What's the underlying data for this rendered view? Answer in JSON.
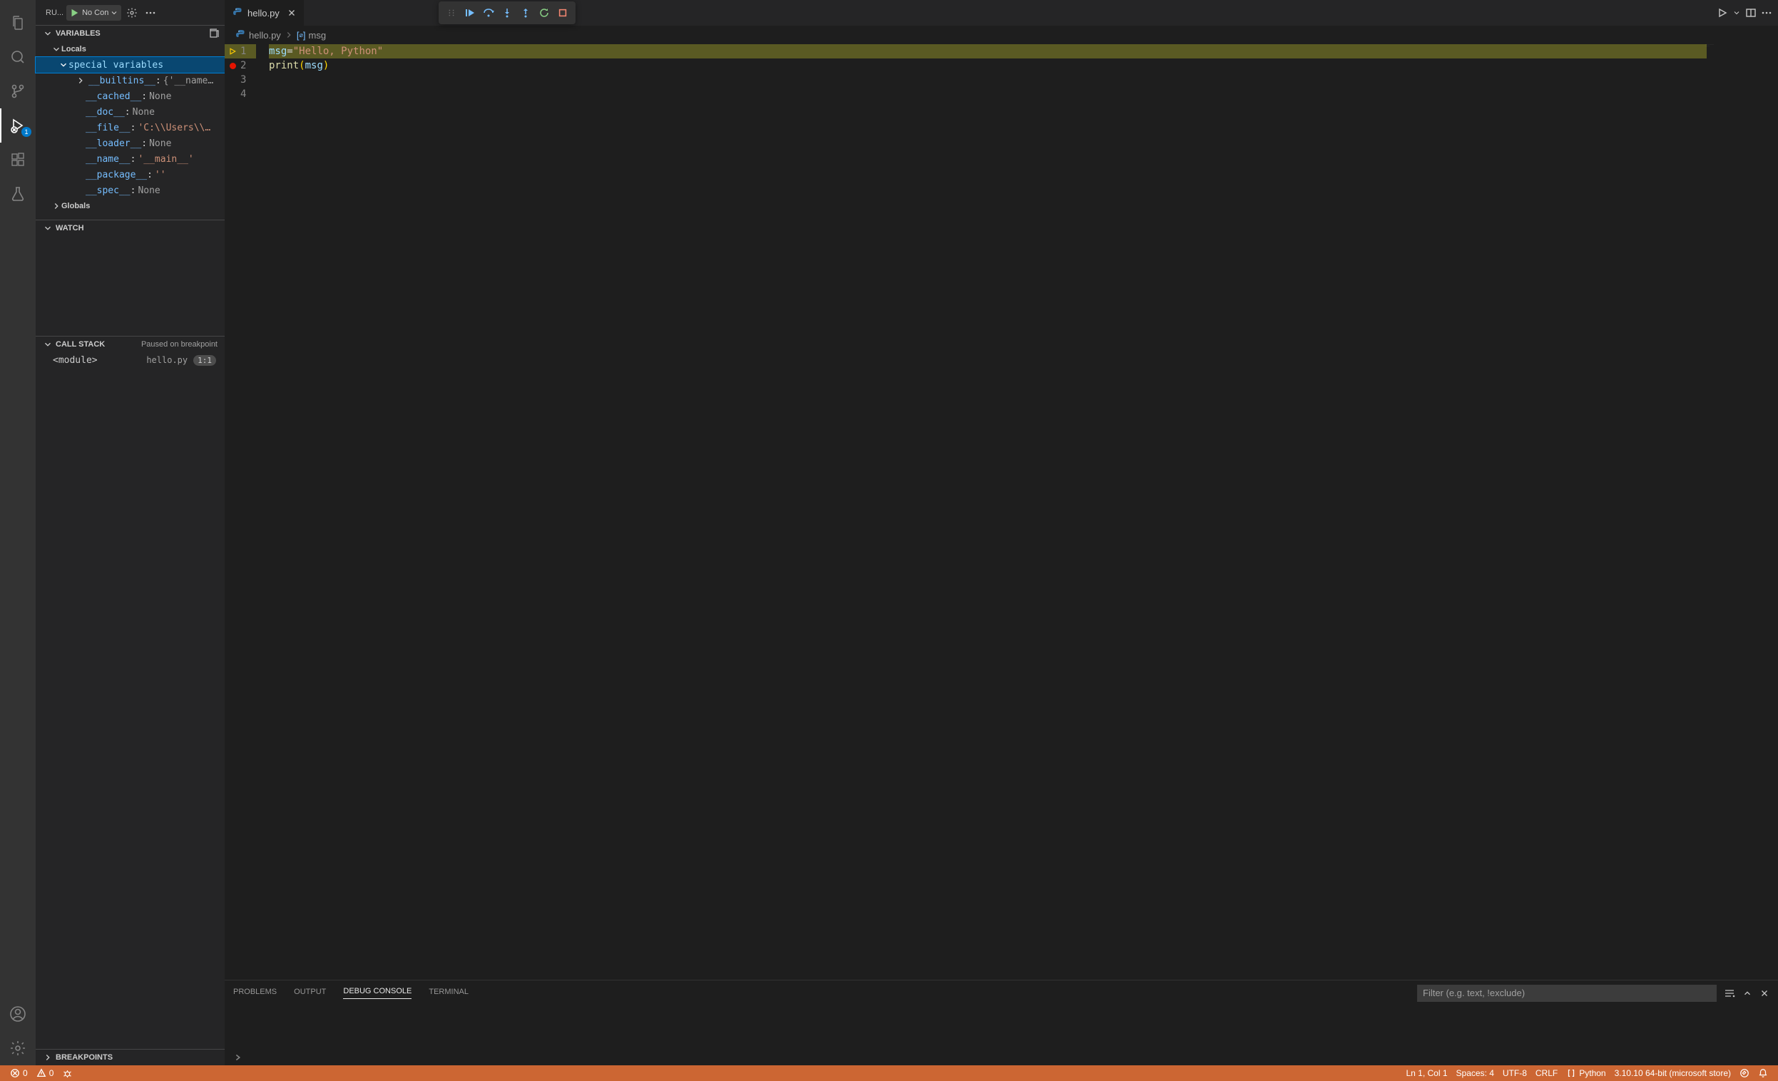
{
  "sidebar": {
    "title": "RU...",
    "run_config": "No Con",
    "sections": {
      "variables": "VARIABLES",
      "watch": "WATCH",
      "callstack": "CALL STACK",
      "callstack_status": "Paused on breakpoint",
      "breakpoints": "BREAKPOINTS"
    },
    "scopes": {
      "locals": "Locals",
      "globals": "Globals"
    },
    "special_vars": "special variables",
    "vars": [
      {
        "name": "__builtins__",
        "value": "{'__name…",
        "expandable": true
      },
      {
        "name": "__cached__",
        "value": "None"
      },
      {
        "name": "__doc__",
        "value": "None"
      },
      {
        "name": "__file__",
        "value": "'C:\\\\Users\\\\…",
        "string": true
      },
      {
        "name": "__loader__",
        "value": "None"
      },
      {
        "name": "__name__",
        "value": "'__main__'",
        "string": true
      },
      {
        "name": "__package__",
        "value": "''",
        "string": true
      },
      {
        "name": "__spec__",
        "value": "None"
      }
    ],
    "stack": {
      "frame": "<module>",
      "file": "hello.py",
      "loc": "1:1"
    }
  },
  "editor": {
    "tab": "hello.py",
    "breadcrumb_file": "hello.py",
    "breadcrumb_symbol": "msg",
    "lines": {
      "l1": "1",
      "l2": "2",
      "l3": "3",
      "l4": "4"
    },
    "code": {
      "msg": "msg",
      "eq": " = ",
      "str": "\"Hello, Python\"",
      "print": "print",
      "lpar": "(",
      "arg": "msg",
      "rpar": ")"
    }
  },
  "panel": {
    "tabs": {
      "problems": "PROBLEMS",
      "output": "OUTPUT",
      "debug": "DEBUG CONSOLE",
      "terminal": "TERMINAL"
    },
    "filter_placeholder": "Filter (e.g. text, !exclude)"
  },
  "statusbar": {
    "errors": "0",
    "warnings": "0",
    "lncol": "Ln 1, Col 1",
    "spaces": "Spaces: 4",
    "encoding": "UTF-8",
    "eol": "CRLF",
    "lang": "Python",
    "interp": "3.10.10 64-bit (microsoft store)"
  },
  "debug_badge": "1"
}
